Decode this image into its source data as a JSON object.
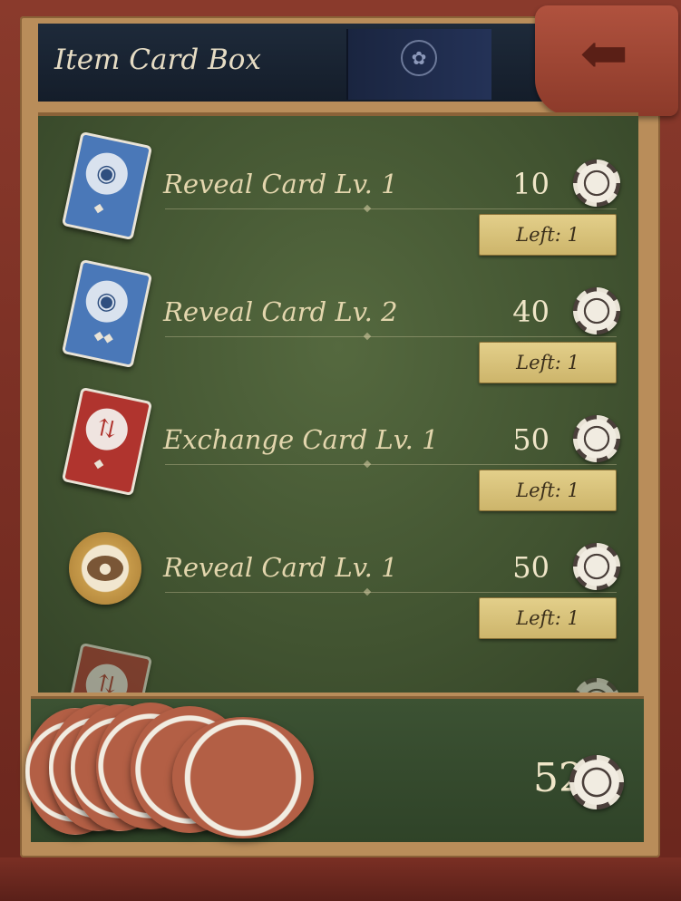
{
  "header": {
    "title": "Item Card Box",
    "book_emblem": "flower-emblem",
    "exit_icon": "exit-door-icon"
  },
  "items": [
    {
      "name": "Reveal Card Lv. 1",
      "price": "10",
      "left": "Left: 1",
      "icon": "reveal-card-blue-icon"
    },
    {
      "name": "Reveal Card Lv. 2",
      "price": "40",
      "left": "Left: 1",
      "icon": "reveal-card-blue-icon"
    },
    {
      "name": "Exchange Card Lv. 1",
      "price": "50",
      "left": "Left: 1",
      "icon": "exchange-card-red-icon"
    },
    {
      "name": "Reveal Card Lv. 1",
      "price": "50",
      "left": "Left: 1",
      "icon": "reveal-watch-gold-icon"
    }
  ],
  "wallet": {
    "balance": "52",
    "currency_icon": "chip-icon"
  },
  "colors": {
    "felt": "#425431",
    "frame": "#7a2f24",
    "gold_badge": "#d6c078",
    "text": "#e3d6ad"
  }
}
